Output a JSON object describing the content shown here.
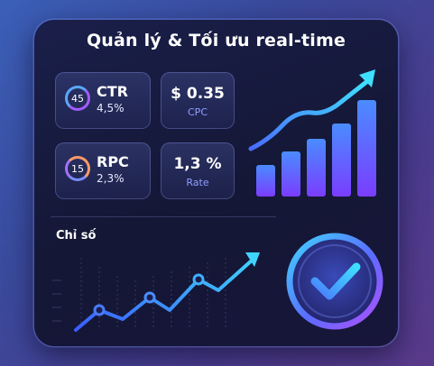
{
  "title": "Quản lý & Tối ưu real-time",
  "cards": {
    "ctr": {
      "score": "45",
      "name": "CTR",
      "value": "4,5%"
    },
    "cpc": {
      "value": "$ 0.35",
      "label": "CPC"
    },
    "rpc": {
      "score": "15",
      "name": "RPC",
      "value": "2,3%"
    },
    "rate": {
      "value": "1,3 %",
      "label": "Rate"
    }
  },
  "line_chart": {
    "label": "Chỉ số"
  },
  "icons": {
    "growth": "bar-growth-icon",
    "trend": "line-trend-icon",
    "check": "check-circle-icon"
  },
  "colors": {
    "accent_cyan": "#3fd4ff",
    "accent_blue": "#4a7bff",
    "accent_purple": "#8a4dff"
  }
}
